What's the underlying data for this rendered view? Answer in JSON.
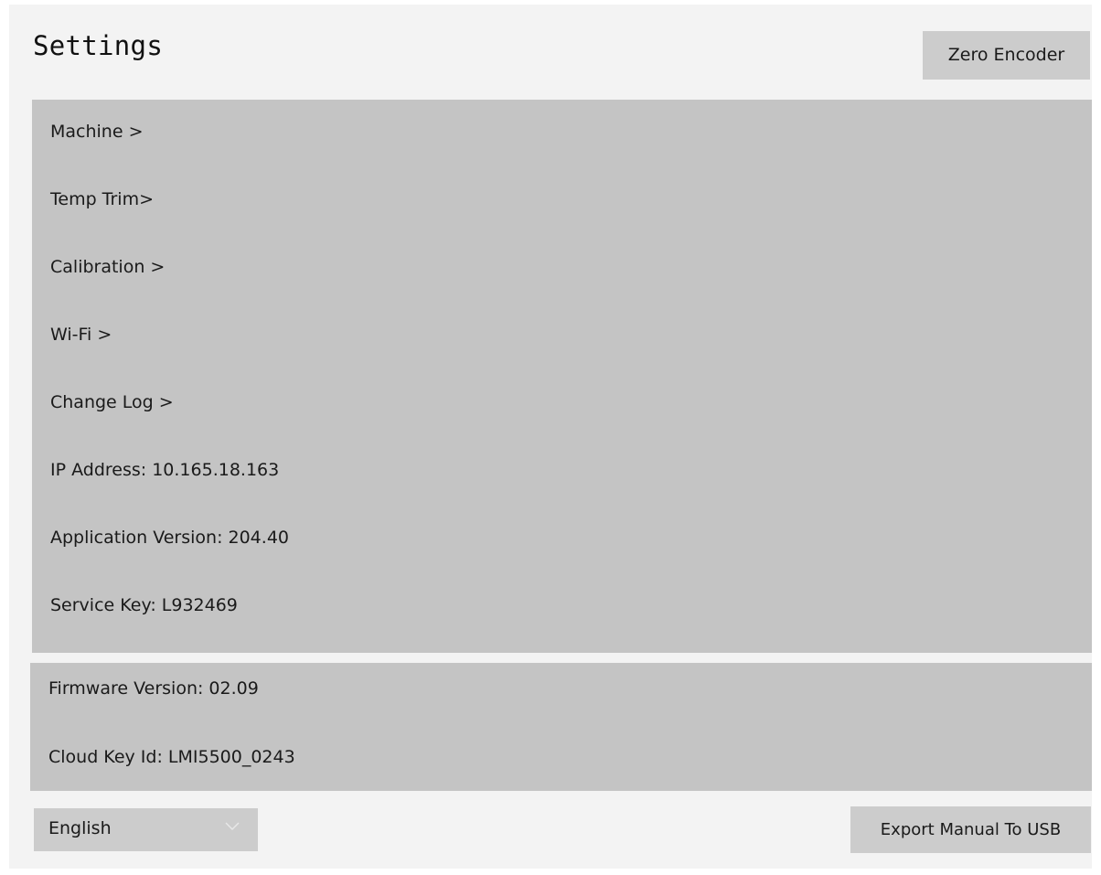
{
  "header": {
    "title": "Settings",
    "zero_encoder_label": "Zero Encoder"
  },
  "menu": {
    "items": [
      {
        "label": "Machine >"
      },
      {
        "label": "Temp Trim>"
      },
      {
        "label": "Calibration >"
      },
      {
        "label": "Wi-Fi >"
      },
      {
        "label": "Change Log >"
      }
    ]
  },
  "info": {
    "ip_address": "IP Address: 10.165.18.163",
    "app_version": "Application Version: 204.40",
    "service_key": "Service Key: L932469",
    "firmware_version": "Firmware Version: 02.09",
    "cloud_key_id": "Cloud Key Id: LMI5500_0243"
  },
  "footer": {
    "language": {
      "selected": "English",
      "icon": "chevron-down-icon"
    },
    "export_label": "Export Manual To USB"
  },
  "colors": {
    "background": "#f3f3f3",
    "panel": "#c4c4c4",
    "button": "#cccccc"
  }
}
